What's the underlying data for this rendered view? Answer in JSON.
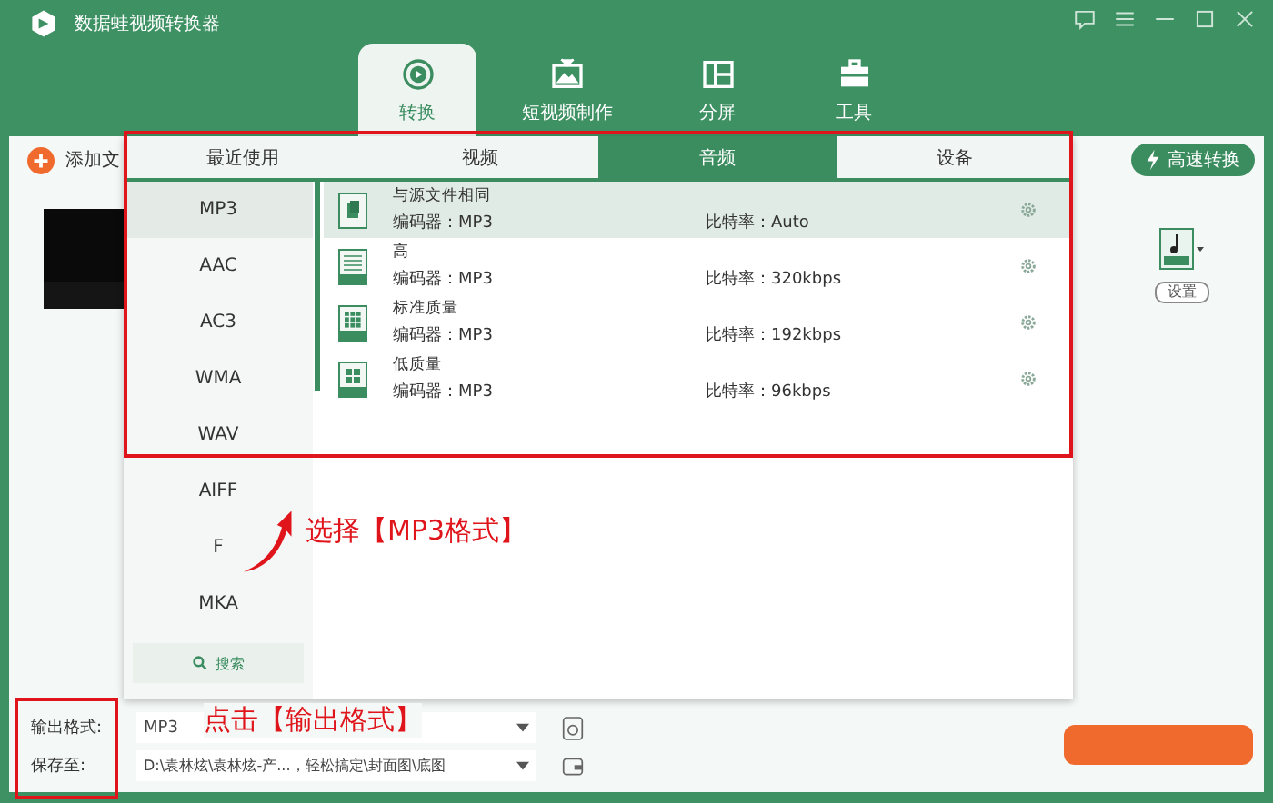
{
  "window": {
    "title": "数据蛙视频转换器"
  },
  "nav_tabs": [
    {
      "label": "转换",
      "selected": true,
      "kind": "convert"
    },
    {
      "label": "短视频制作",
      "selected": false,
      "kind": "video"
    },
    {
      "label": "分屏",
      "selected": false,
      "kind": "split"
    },
    {
      "label": "工具",
      "selected": false,
      "kind": "tools"
    }
  ],
  "toolbar": {
    "add_file": "添加文",
    "fast_convert": "高速转换",
    "settings_button": "设置"
  },
  "format_popup": {
    "tabs": [
      {
        "label": "最近使用",
        "selected": false
      },
      {
        "label": "视频",
        "selected": false
      },
      {
        "label": "音频",
        "selected": true
      },
      {
        "label": "设备",
        "selected": false
      }
    ],
    "formats": [
      {
        "label": "MP3",
        "selected": true
      },
      {
        "label": "AAC",
        "selected": false
      },
      {
        "label": "AC3",
        "selected": false
      },
      {
        "label": "WMA",
        "selected": false
      },
      {
        "label": "WAV",
        "selected": false
      },
      {
        "label": "AIFF",
        "selected": false
      },
      {
        "label": "F",
        "selected": false
      },
      {
        "label": "MKA",
        "selected": false
      }
    ],
    "search": "搜索",
    "presets": [
      {
        "name": "与源文件相同",
        "encoder_label": "编码器：",
        "encoder": "MP3",
        "bitrate_label": "比特率：",
        "bitrate": "Auto",
        "selected": true,
        "kind": "same"
      },
      {
        "name": "高",
        "encoder_label": "编码器：",
        "encoder": "MP3",
        "bitrate_label": "比特率：",
        "bitrate": "320kbps",
        "selected": false,
        "kind": "high"
      },
      {
        "name": "标准质量",
        "encoder_label": "编码器：",
        "encoder": "MP3",
        "bitrate_label": "比特率：",
        "bitrate": "192kbps",
        "selected": false,
        "kind": "standard"
      },
      {
        "name": "低质量",
        "encoder_label": "编码器：",
        "encoder": "MP3",
        "bitrate_label": "比特率：",
        "bitrate": "96kbps",
        "selected": false,
        "kind": "low"
      }
    ]
  },
  "output": {
    "format_label": "输出格式:",
    "format_value": "MP3",
    "save_label": "保存至:",
    "save_path": "D:\\袁林炫\\袁林炫-产...，轻松搞定\\封面图\\底图"
  },
  "annotations": [
    {
      "text": "选择【MP3格式】"
    },
    {
      "text": "点击【输出格式】"
    }
  ]
}
